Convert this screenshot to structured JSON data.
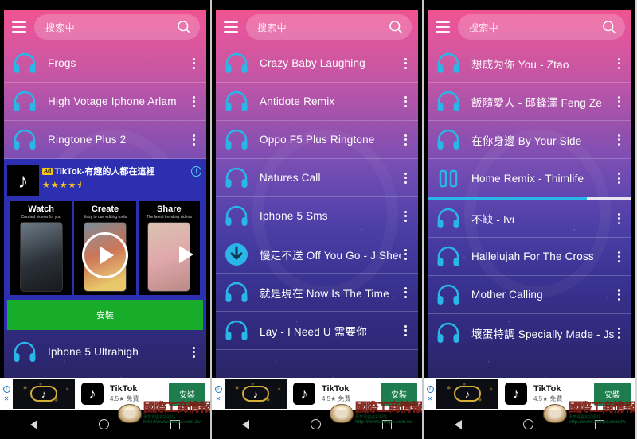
{
  "app": {
    "search": {
      "placeholder": "搜索中",
      "menu_icon": "hamburger-menu-icon",
      "search_icon": "search-icon"
    },
    "accent_blue": "#29b6e8",
    "install_green": "#17ad2a",
    "ad_blue": "#2b2fb0"
  },
  "bottom_nav": [
    {
      "name": "nav-grid",
      "label": "grid-icon",
      "active": true
    },
    {
      "name": "nav-list",
      "label": "list-icon",
      "active": false
    },
    {
      "name": "nav-profile",
      "label": "person-icon",
      "active": false
    },
    {
      "name": "nav-folder",
      "label": "folder-icon",
      "active": false
    }
  ],
  "system_nav": {
    "back": "back-triangle",
    "home": "home-circle",
    "recents": "recents-square"
  },
  "banner_ad": {
    "app_name": "TikTok",
    "rating": "4.5★ 免費",
    "cta": "安裝",
    "info_label": "i",
    "close_label": "✕"
  },
  "watermark": {
    "main": "國際工商情報",
    "sub": "專業電腦資訊網站",
    "url": "http://www.kocpc.com.tw"
  },
  "panels": [
    {
      "id": "panel-left",
      "items_top": [
        {
          "title": "Frogs",
          "icon": "headphone-icon"
        },
        {
          "title": "High Votage Iphone Arlam",
          "icon": "headphone-icon"
        },
        {
          "title": "Ringtone Plus 2",
          "icon": "headphone-icon"
        }
      ],
      "interstitial_ad": {
        "badge": "Ad",
        "headline": "TikTok-有趣的人都在這裡",
        "stars": "★★★★⯨",
        "install": "安裝",
        "info_label": "i",
        "cards": [
          {
            "heading": "Watch",
            "sub": "Curated videos for you"
          },
          {
            "heading": "Create",
            "sub": "Easy to use editing tools"
          },
          {
            "heading": "Share",
            "sub": "The latest trending videos"
          }
        ]
      },
      "items_bottom": [
        {
          "title": "Iphone 5 Ultrahigh",
          "icon": "headphone-icon"
        }
      ]
    },
    {
      "id": "panel-middle",
      "items": [
        {
          "title": "Crazy Baby Laughing",
          "icon": "headphone-icon"
        },
        {
          "title": "Antidote Remix",
          "icon": "headphone-icon"
        },
        {
          "title": "Oppo F5 Plus Ringtone",
          "icon": "headphone-icon"
        },
        {
          "title": "Natures Call",
          "icon": "headphone-icon"
        },
        {
          "title": "Iphone 5 Sms",
          "icon": "headphone-icon"
        },
        {
          "title": "慢走不送 Off You Go - J Sheon",
          "icon": "download-icon"
        },
        {
          "title": "就是現在 Now Is The Time",
          "icon": "headphone-icon"
        },
        {
          "title": "Lay - I Need U 需要你",
          "icon": "headphone-icon"
        }
      ]
    },
    {
      "id": "panel-right",
      "items": [
        {
          "title": "想成为你 You - Ztao",
          "icon": "headphone-icon"
        },
        {
          "title": "飯隨愛人 - 邱鋒澤 Feng Ze",
          "icon": "headphone-icon"
        },
        {
          "title": "在你身邊 By Your Side",
          "icon": "headphone-icon"
        },
        {
          "title": "Home Remix - Thimlife",
          "icon": "pause-icon",
          "playing": true,
          "progress_percent": 78
        },
        {
          "title": "不缺 - Ivi",
          "icon": "headphone-icon"
        },
        {
          "title": "Hallelujah For The Cross",
          "icon": "headphone-icon"
        },
        {
          "title": "Mother Calling",
          "icon": "headphone-icon"
        },
        {
          "title": "壞蛋特調 Specially Made - Jsheon",
          "icon": "headphone-icon"
        }
      ]
    }
  ]
}
